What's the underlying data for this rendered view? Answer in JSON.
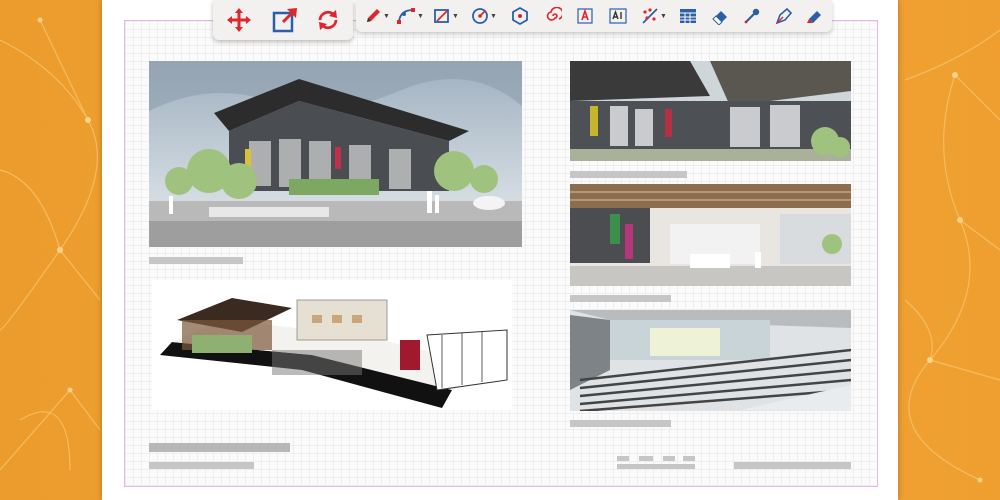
{
  "colors": {
    "background": "#f0a030",
    "sheet": "#ffffff",
    "tool_red": "#e0262d",
    "tool_blue": "#2b5fa8",
    "placeholder_bar": "#c6c6c6"
  },
  "toolbar": {
    "primary_tools": [
      "move-icon",
      "transform-box-icon",
      "rotate-icon"
    ],
    "tools": [
      "pencil-icon",
      "bezier-curve-icon",
      "rectangle-icon",
      "circle-icon",
      "polygon-icon",
      "spiral-icon",
      "text-tool-icon",
      "ai-text-icon",
      "scatter-icon",
      "table-icon",
      "eraser-icon",
      "eyedropper-icon",
      "pen-nib-icon",
      "highlighter-icon"
    ]
  },
  "document": {
    "panels": [
      "exterior-rendering",
      "atrium-upper-rendering",
      "atrium-lobby-rendering",
      "isometric-section-drawing",
      "auditorium-rendering"
    ]
  }
}
